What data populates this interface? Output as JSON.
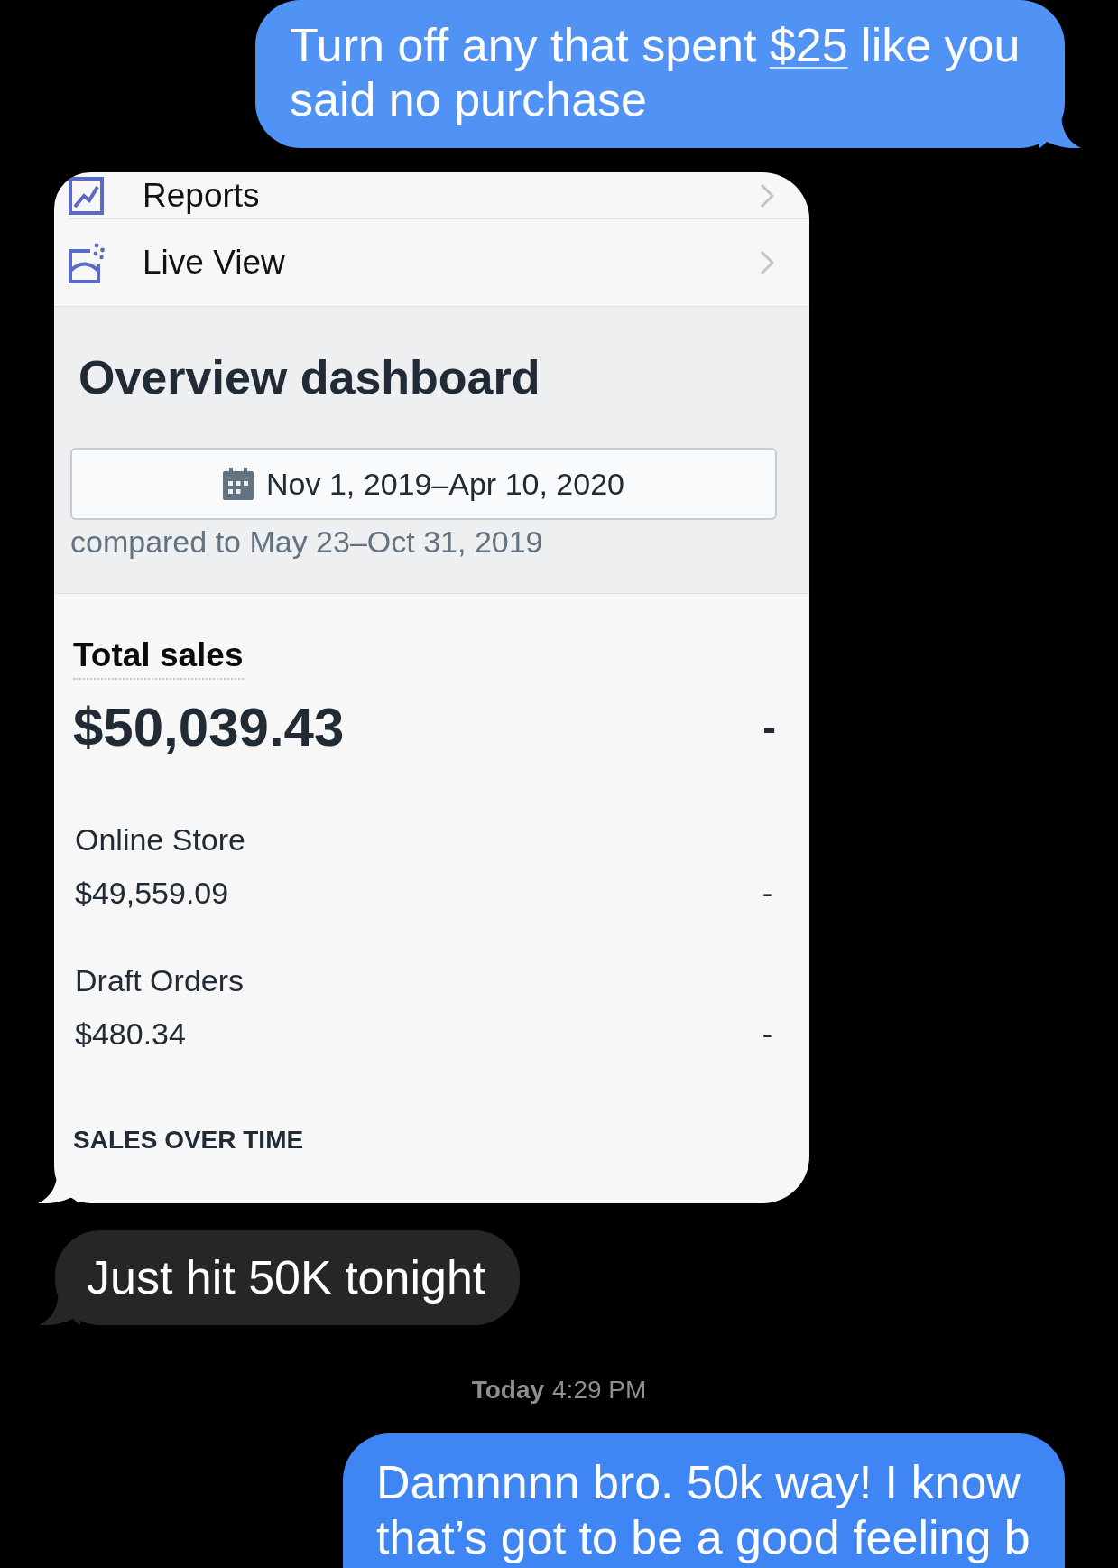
{
  "sent_message": {
    "text_before": "Turn off any that spent ",
    "link": "$25",
    "text_after": " like you said no purchase"
  },
  "shared_screenshot": {
    "nav_items": [
      {
        "kind": "reports",
        "label": "Reports"
      },
      {
        "kind": "live",
        "label": "Live View"
      }
    ],
    "title": "Overview dashboard",
    "date_range": "Nov 1, 2019–Apr 10, 2020",
    "comparison": "compared to May 23–Oct 31, 2019",
    "total_sales": {
      "title": "Total sales",
      "value": "$50,039.43",
      "change": "-"
    },
    "channels": [
      {
        "label": "Online Store",
        "value": "$49,559.09",
        "change": "-"
      },
      {
        "label": "Draft Orders",
        "value": "$480.34",
        "change": "-"
      }
    ],
    "section_heading": "SALES OVER TIME"
  },
  "received_message": {
    "text": "Just hit 50K tonight"
  },
  "timestamp": {
    "day": "Today",
    "time": "4:29 PM"
  },
  "reply_message": {
    "text": "Damnnnn bro. 50k way! I know that’s got to be a good feeling b"
  }
}
